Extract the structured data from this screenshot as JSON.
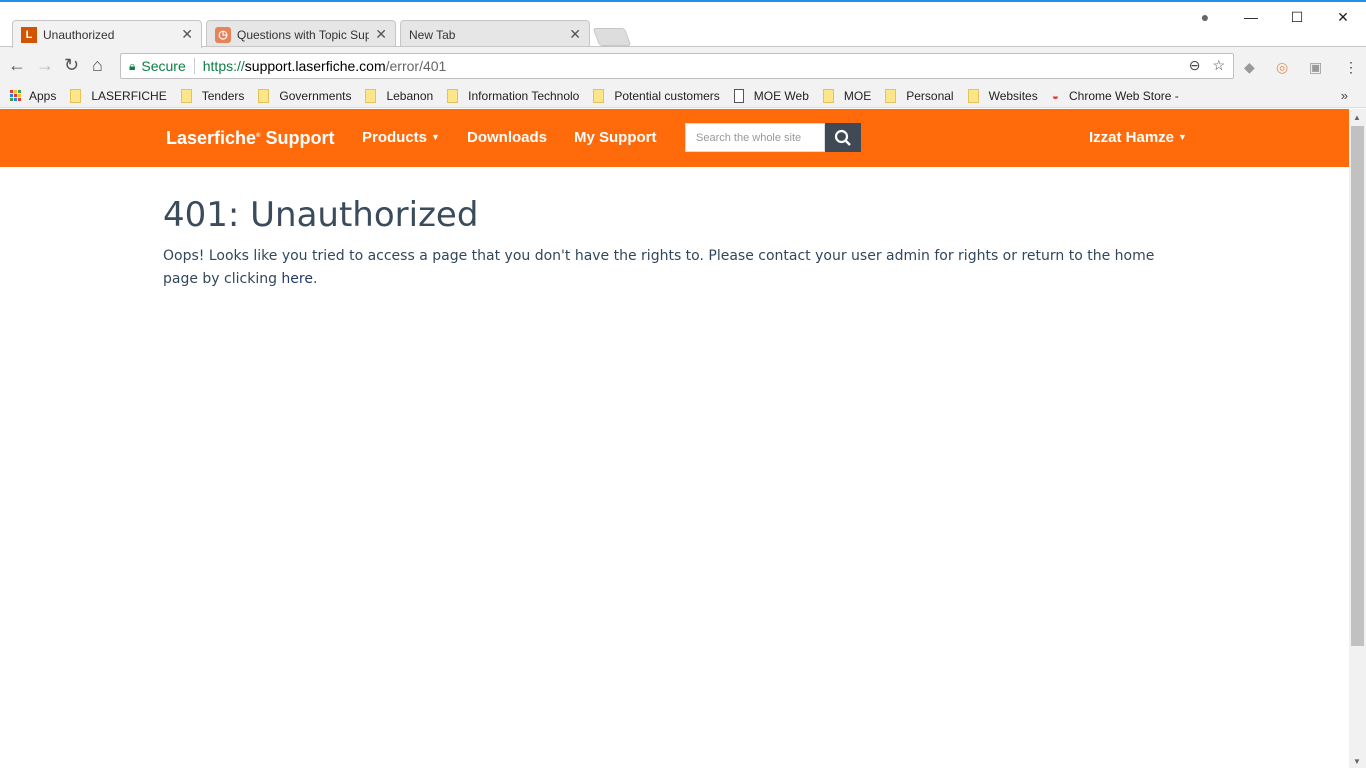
{
  "browser": {
    "tabs": [
      {
        "label": "Unauthorized",
        "icon": "L"
      },
      {
        "label": "Questions with Topic Support",
        "icon": "clock"
      },
      {
        "label": "New Tab"
      }
    ],
    "security_label": "Secure",
    "url": {
      "scheme": "https://",
      "host": "support.laserfiche.com",
      "path": "/error/401"
    },
    "bookmarks": [
      "Apps",
      "LASERFICHE",
      "Tenders",
      "Governments",
      "Lebanon",
      "Information Technolo",
      "Potential customers",
      "MOE Web",
      "MOE",
      "Personal",
      "Websites",
      "Chrome Web Store -"
    ]
  },
  "site": {
    "brand": "Laserfiche",
    "brand_suffix": "Support",
    "nav": {
      "products": "Products",
      "downloads": "Downloads",
      "my_support": "My Support"
    },
    "search_placeholder": "Search the whole site",
    "user": "Izzat Hamze",
    "accent": "#ff6a0a"
  },
  "page": {
    "title": "401: Unauthorized",
    "message": "Oops! Looks like you tried to access a page that you don't have the rights to. Please contact your user admin for rights or return to the home page by clicking ",
    "link": "here",
    "end": "."
  }
}
